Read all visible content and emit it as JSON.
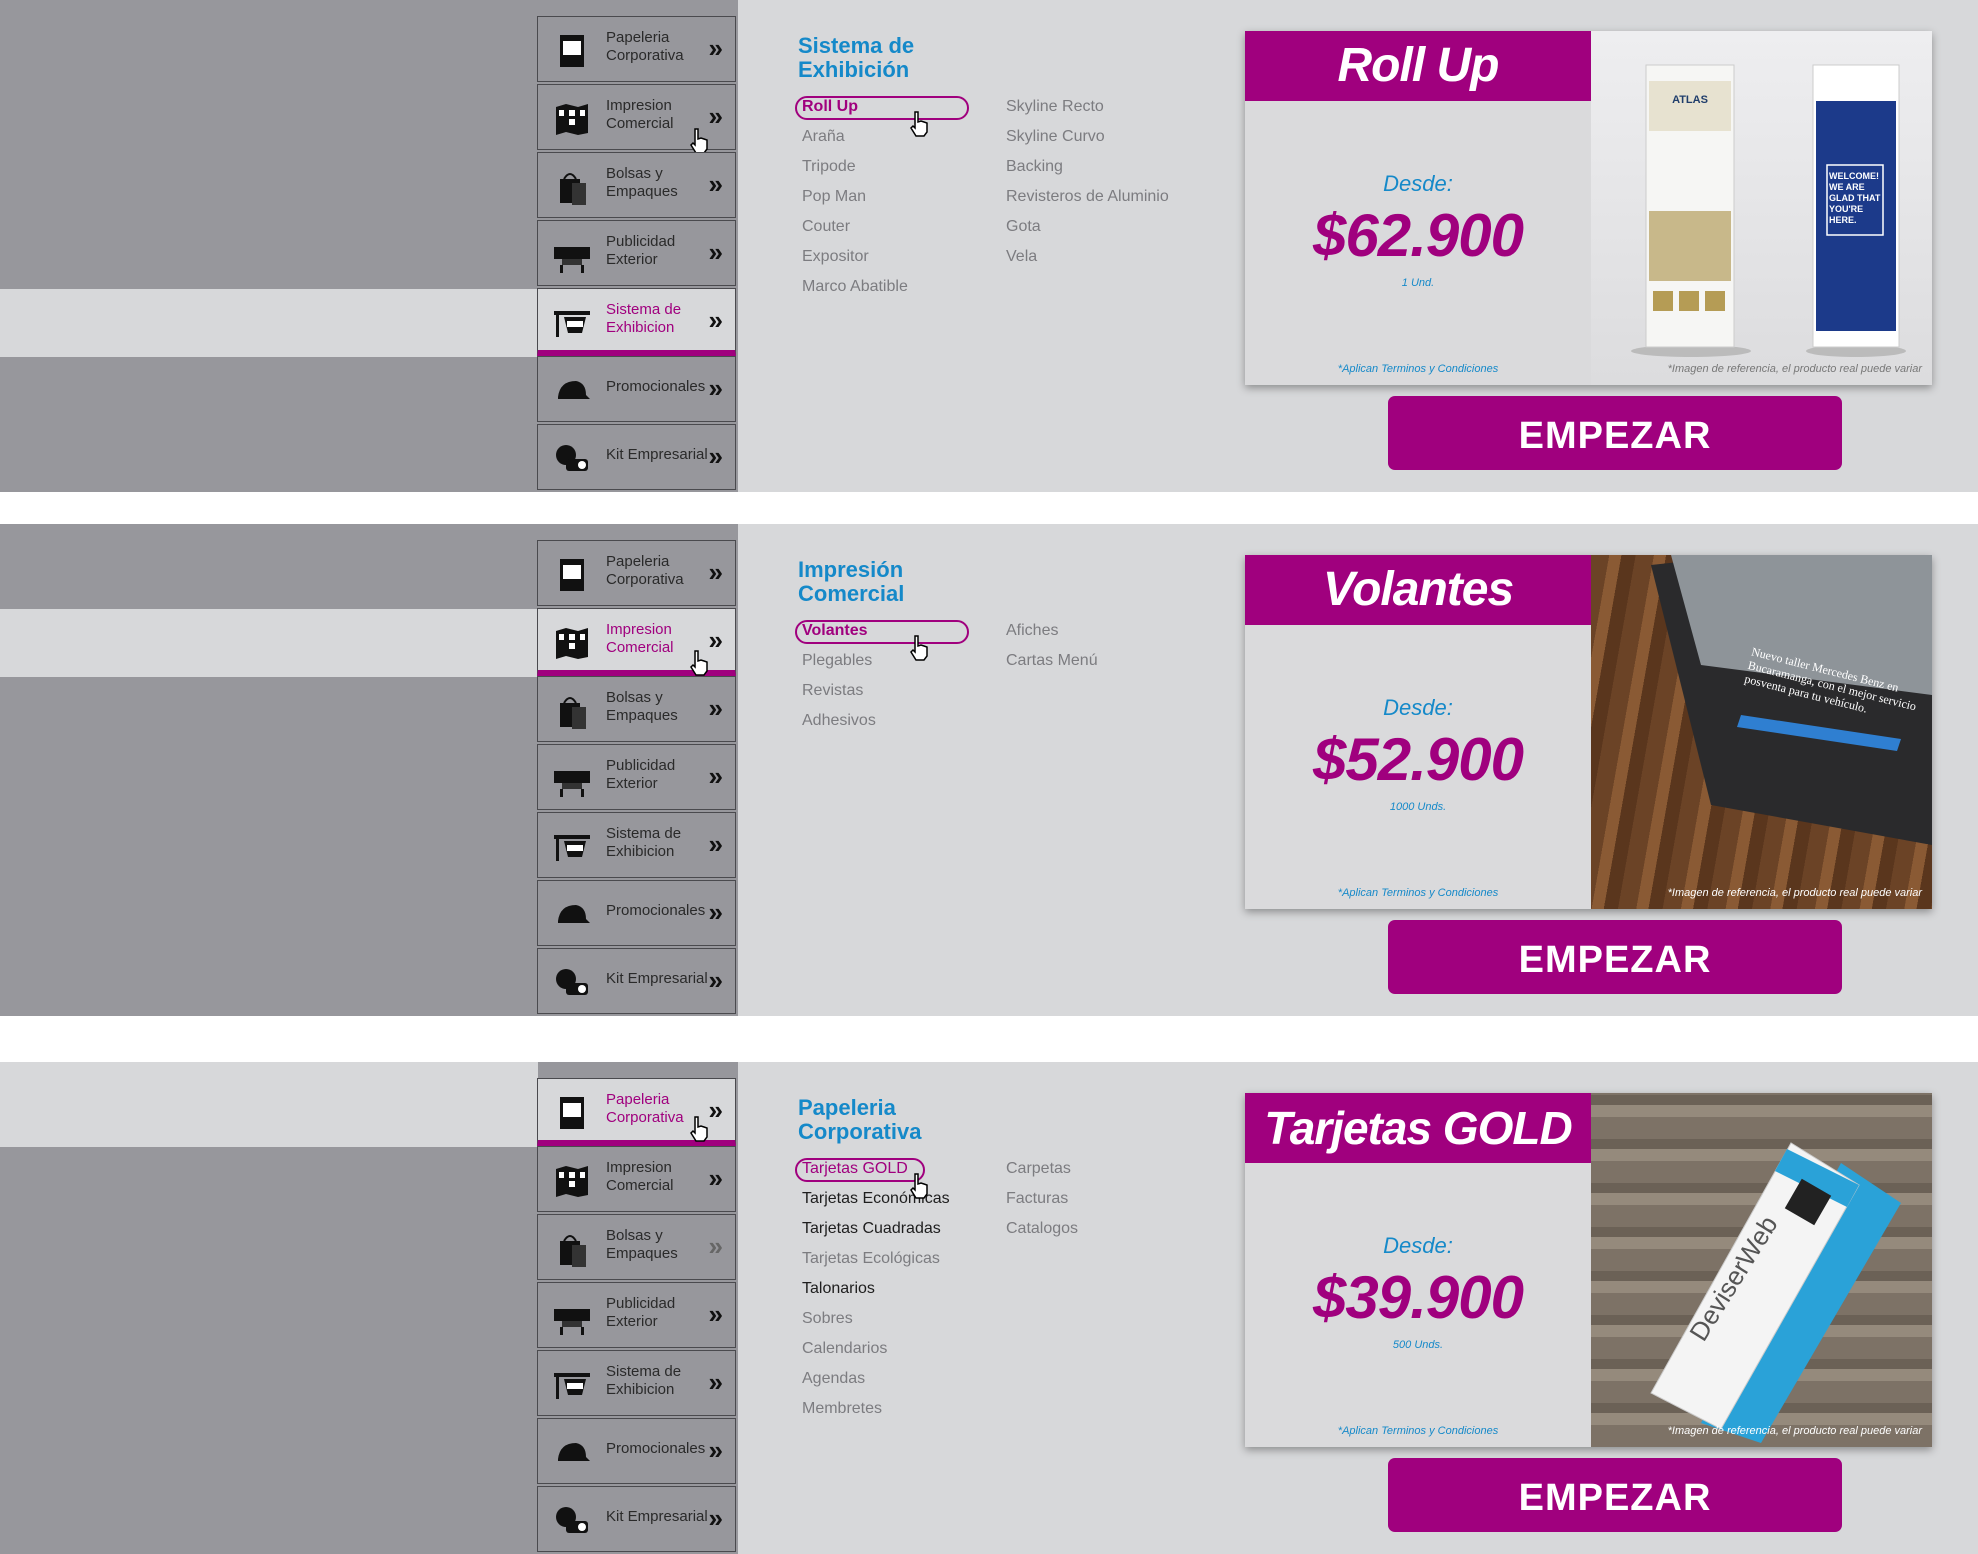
{
  "nav_labels": {
    "papeleria": "Papeleria\nCorporativa",
    "impresion": "Impresion\nComercial",
    "bolsas": "Bolsas y\nEmpaques",
    "publicidad": "Publicidad\nExterior",
    "sistema": "Sistema de\nExhibicion",
    "promocionales": "Promocionales",
    "kit": "Kit Empresarial"
  },
  "panels": [
    {
      "category_title": "Sistema de\nExhibición",
      "active_nav": "sistema",
      "subcategories_col1": [
        "Roll Up",
        "Araña",
        "Tripode",
        "Pop Man",
        "Couter",
        "Expositor",
        "Marco Abatible"
      ],
      "subcategories_col2": [
        "Skyline Recto",
        "Skyline Curvo",
        "Backing",
        "Revisteros de Aluminio",
        "Gota",
        "Vela"
      ],
      "selected": "Roll Up",
      "product": {
        "title": "Roll Up",
        "desde": "Desde:",
        "price": "$62.900",
        "quantity": "1 Und.",
        "terms": "*Aplican Terminos y Condiciones",
        "reference_note": "*Imagen de referencia, el producto real puede variar",
        "banner_left_text": "ATLAS",
        "banner_right_text": "WELCOME! WE ARE GLAD THAT YOU'RE HERE."
      },
      "cta": "EMPEZAR"
    },
    {
      "category_title": "Impresión\nComercial",
      "active_nav": "impresion",
      "subcategories_col1": [
        "Volantes",
        "Plegables",
        "Revistas",
        "Adhesivos"
      ],
      "subcategories_col2": [
        "Afiches",
        "Cartas Menú"
      ],
      "selected": "Volantes",
      "product": {
        "title": "Volantes",
        "desde": "Desde:",
        "price": "$52.900",
        "quantity": "1000 Unds.",
        "terms": "*Aplican Terminos y Condiciones",
        "reference_note": "*Imagen de referencia, el producto real puede variar",
        "flyer_text": "Nuevo taller Mercedes Benz en Bucaramanga, con el mejor servicio posventa para tu vehículo."
      },
      "cta": "EMPEZAR"
    },
    {
      "category_title": "Papeleria\nCorporativa",
      "active_nav": "papeleria",
      "subcategories_col1": [
        "Tarjetas GOLD",
        "Tarjetas Económicas",
        "Tarjetas Cuadradas",
        "Tarjetas Ecológicas",
        "Talonarios",
        "Sobres",
        "Calendarios",
        "Agendas",
        "Membretes"
      ],
      "subcategories_col2": [
        "Carpetas",
        "Facturas",
        "Catalogos"
      ],
      "selected": "Tarjetas GOLD",
      "product": {
        "title": "Tarjetas GOLD",
        "desde": "Desde:",
        "price": "$39.900",
        "quantity": "500 Unds.",
        "terms": "*Aplican Terminos y Condiciones",
        "reference_note": "*Imagen de referencia, el producto real puede variar",
        "card_brand": "DeviserWeb"
      },
      "cta": "EMPEZAR"
    }
  ],
  "colors": {
    "accent": "#a0007e",
    "blue": "#1589c9",
    "panel": "#d7d8da",
    "sidebar": "#97979c"
  },
  "icons": [
    "folder-icon",
    "brochure-icon",
    "bag-icon",
    "printer-icon",
    "display-stand-icon",
    "cap-icon",
    "gift-icon",
    "chevron-double-icon",
    "hand-cursor-icon"
  ]
}
